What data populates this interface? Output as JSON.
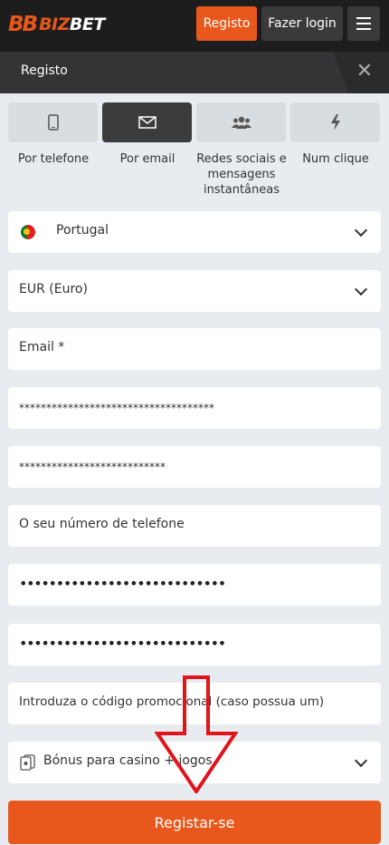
{
  "header": {
    "logo_mark": "BB",
    "logo_text_1": "BIZ",
    "logo_text_2": "BET",
    "register_label": "Registo",
    "login_label": "Fazer login",
    "menu_icon": "hamburger-icon"
  },
  "subheader": {
    "title": "Registo",
    "close_icon": "close-icon"
  },
  "tabs": [
    {
      "label": "Por telefone",
      "icon": "phone-icon"
    },
    {
      "label": "Por email",
      "icon": "envelope-icon",
      "active": true
    },
    {
      "label": "Redes sociais e mensagens instantâneas",
      "icon": "users-icon"
    },
    {
      "label": "Num clique",
      "icon": "lightning-icon"
    }
  ],
  "form": {
    "country": "Portugal",
    "currency": "EUR (Euro)",
    "email_placeholder": "Email  *",
    "masked_1": "************************************",
    "masked_2": "***************************",
    "phone_placeholder": "O seu número de telefone",
    "password": "••••••••••••••••••••••••••••",
    "password_confirm": "••••••••••••••••••••••••••••",
    "promo_placeholder": "Introduza o código promocional (caso possua um)",
    "bonus": "Bónus para casino + jogos",
    "submit_label": "Registar-se"
  },
  "colors": {
    "accent": "#e8581c",
    "topbar": "#1d1d1d",
    "subbar": "#333436",
    "background": "#e8ecf0",
    "arrow": "#e0141a"
  }
}
